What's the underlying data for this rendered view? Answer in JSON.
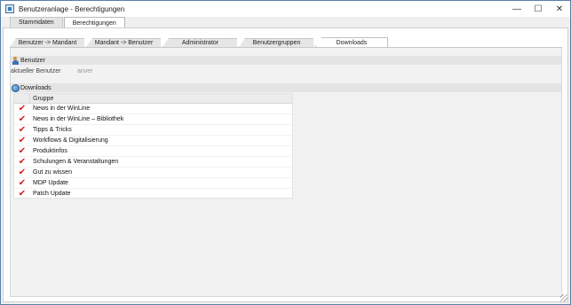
{
  "window": {
    "title": "Benutzeranlage - Berechtigungen",
    "minimize": "—",
    "maximize": "☐",
    "close": "✕"
  },
  "top_tabs": [
    {
      "label": "Stammdaten",
      "active": false
    },
    {
      "label": "Berechtigungen",
      "active": true
    }
  ],
  "sub_tabs": [
    {
      "label": "Benutzer -> Mandant",
      "active": false
    },
    {
      "label": "Mandant -> Benutzer",
      "active": false
    },
    {
      "label": "Administrator",
      "active": false
    },
    {
      "label": "Benutzergruppen",
      "active": false
    },
    {
      "label": "Downloads",
      "active": true
    }
  ],
  "benutzer_section": {
    "title": "Benutzer",
    "icon": "user-icon",
    "field_label": "aktueller Benutzer",
    "field_value": "anver"
  },
  "downloads_section": {
    "title": "Downloads",
    "icon": "globe-icon",
    "column_header": "Gruppe",
    "rows": [
      {
        "label": "News in der WinLine",
        "checked": true
      },
      {
        "label": "News in der WinLine – Bibliothek",
        "checked": true
      },
      {
        "label": "Tipps & Tricks",
        "checked": true
      },
      {
        "label": "Workflows & Digitalisierung",
        "checked": true
      },
      {
        "label": "Produktinfos",
        "checked": true
      },
      {
        "label": "Schulungen & Veranstaltungen",
        "checked": true
      },
      {
        "label": "Gut zu wissen",
        "checked": true
      },
      {
        "label": "MDP Update",
        "checked": true
      },
      {
        "label": "Patch Update",
        "checked": true
      }
    ],
    "check_glyph": "✔",
    "check_color": "#d42020"
  }
}
